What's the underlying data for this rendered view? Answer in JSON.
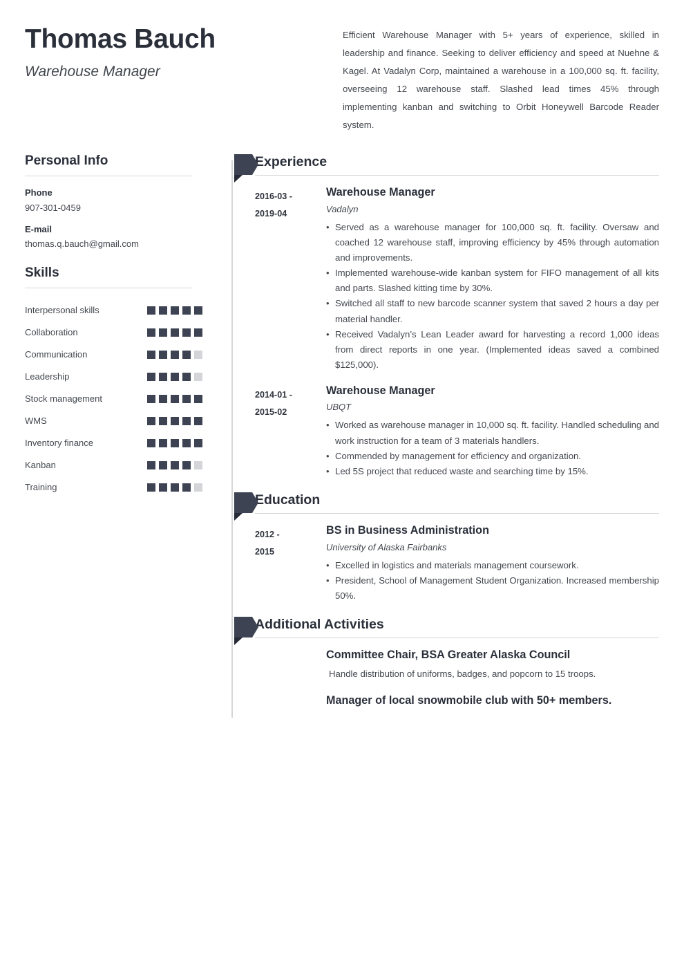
{
  "theme": {
    "accent_dark": "#3d4352",
    "accent_fold": "#252a36",
    "heading_color": "#2a2f3a",
    "body_color": "#43474e",
    "rule_color": "#d4d6d9",
    "skill_empty": "#d3d5d8"
  },
  "header": {
    "name": "Thomas Bauch",
    "job_title": "Warehouse Manager",
    "summary": "Efficient Warehouse Manager with 5+ years of experience, skilled in leadership and finance. Seeking to deliver efficiency and speed at Nuehne & Kagel. At Vadalyn Corp, maintained a warehouse in a 100,000 sq. ft. facility, overseeing 12 warehouse staff. Slashed lead times 45% through implementing kanban and switching to Orbit Honeywell Barcode Reader system."
  },
  "personal_info": {
    "heading": "Personal Info",
    "fields": [
      {
        "label": "Phone",
        "value": "907-301-0459"
      },
      {
        "label": "E-mail",
        "value": "thomas.q.bauch@gmail.com"
      }
    ]
  },
  "skills": {
    "heading": "Skills",
    "max_level": 5,
    "items": [
      {
        "name": "Interpersonal skills",
        "level": 5
      },
      {
        "name": "Collaboration",
        "level": 5
      },
      {
        "name": "Communication",
        "level": 4
      },
      {
        "name": "Leadership",
        "level": 4
      },
      {
        "name": "Stock management",
        "level": 5
      },
      {
        "name": "WMS",
        "level": 5
      },
      {
        "name": "Inventory finance",
        "level": 5
      },
      {
        "name": "Kanban",
        "level": 4
      },
      {
        "name": "Training",
        "level": 4
      }
    ]
  },
  "experience": {
    "heading": "Experience",
    "entries": [
      {
        "date_from": "2016-03 -",
        "date_to": "2019-04",
        "title": "Warehouse Manager",
        "org": "Vadalyn",
        "bullets": [
          "Served as a warehouse manager for 100,000 sq. ft. facility. Oversaw and coached 12 warehouse staff, improving efficiency by 45% through automation and improvements.",
          "Implemented warehouse-wide kanban system for FIFO management of all kits and parts. Slashed kitting time by 30%.",
          "Switched all staff to new barcode scanner system that saved 2 hours a day per material handler.",
          "Received Vadalyn’s Lean Leader award for harvesting a record 1,000 ideas from direct reports in one year. (Implemented ideas saved a combined $125,000)."
        ]
      },
      {
        "date_from": "2014-01 -",
        "date_to": "2015-02",
        "title": "Warehouse Manager",
        "org": "UBQT",
        "bullets": [
          "Worked as warehouse manager in 10,000 sq. ft. facility. Handled scheduling and work instruction for a team of 3 materials handlers.",
          "Commended by management for efficiency and organization.",
          "Led 5S project that reduced waste and searching time by 15%."
        ]
      }
    ]
  },
  "education": {
    "heading": "Education",
    "entries": [
      {
        "date_from": "2012 -",
        "date_to": "2015",
        "title": "BS in Business Administration",
        "org": "University of Alaska Fairbanks",
        "bullets": [
          "Excelled in logistics and materials management coursework.",
          "President, School of Management Student Organization. Increased membership 50%."
        ]
      }
    ]
  },
  "additional_activities": {
    "heading": "Additional Activities",
    "entries": [
      {
        "title": "Committee Chair, BSA Greater Alaska Council",
        "description": "Handle distribution of uniforms, badges, and popcorn to 15 troops."
      },
      {
        "title": "Manager of local snowmobile club with 50+ members.",
        "description": ""
      }
    ]
  }
}
